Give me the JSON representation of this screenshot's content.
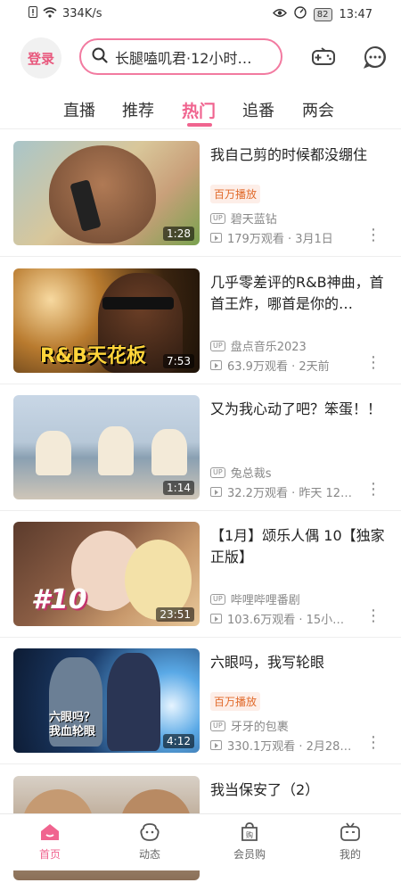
{
  "status": {
    "speed": "334K/s",
    "battery": "82",
    "time": "13:47"
  },
  "header": {
    "login": "登录",
    "search_text": "长腿嗑叽君·12小时…"
  },
  "tabs": [
    "直播",
    "推荐",
    "热门",
    "追番",
    "两会"
  ],
  "active_tab": "热门",
  "feed": [
    {
      "title": "我自己剪的时候都没绷住",
      "badge": "百万播放",
      "uploader": "碧天蓝钻",
      "meta": "179万观看 · 3月1日",
      "duration": "1:28"
    },
    {
      "title": "几乎零差评的R&B神曲，首首王炸，哪首是你的…",
      "badge": "",
      "uploader": "盘点音乐2023",
      "meta": "63.9万观看 · 2天前",
      "duration": "7:53",
      "thumb_text": "R&B天花板"
    },
    {
      "title": "又为我心动了吧？笨蛋！！",
      "badge": "",
      "uploader": "兔总裁s",
      "meta": "32.2万观看 · 昨天 12…",
      "duration": "1:14"
    },
    {
      "title": "【1月】颂乐人偶 10【独家正版】",
      "badge": "",
      "uploader": "哔哩哔哩番剧",
      "meta": "103.6万观看 · 15小…",
      "duration": "23:51",
      "thumb_text": "#10"
    },
    {
      "title": "六眼吗，我写轮眼",
      "badge": "百万播放",
      "uploader": "牙牙的包裹",
      "meta": "330.1万观看 · 2月28…",
      "duration": "4:12",
      "thumb_text": "六眼吗？\n我血轮眼"
    },
    {
      "title": "我当保安了（2）",
      "badge": "",
      "uploader": "",
      "meta": "",
      "duration": ""
    }
  ],
  "up_label": "UP",
  "bottom_nav": [
    {
      "label": "首页",
      "icon": "home-icon"
    },
    {
      "label": "动态",
      "icon": "dynamic-icon"
    },
    {
      "label": "会员购",
      "icon": "shop-icon"
    },
    {
      "label": "我的",
      "icon": "tv-icon"
    }
  ],
  "colors": {
    "accent": "#f0648f",
    "badge_text": "#e16a2a"
  }
}
